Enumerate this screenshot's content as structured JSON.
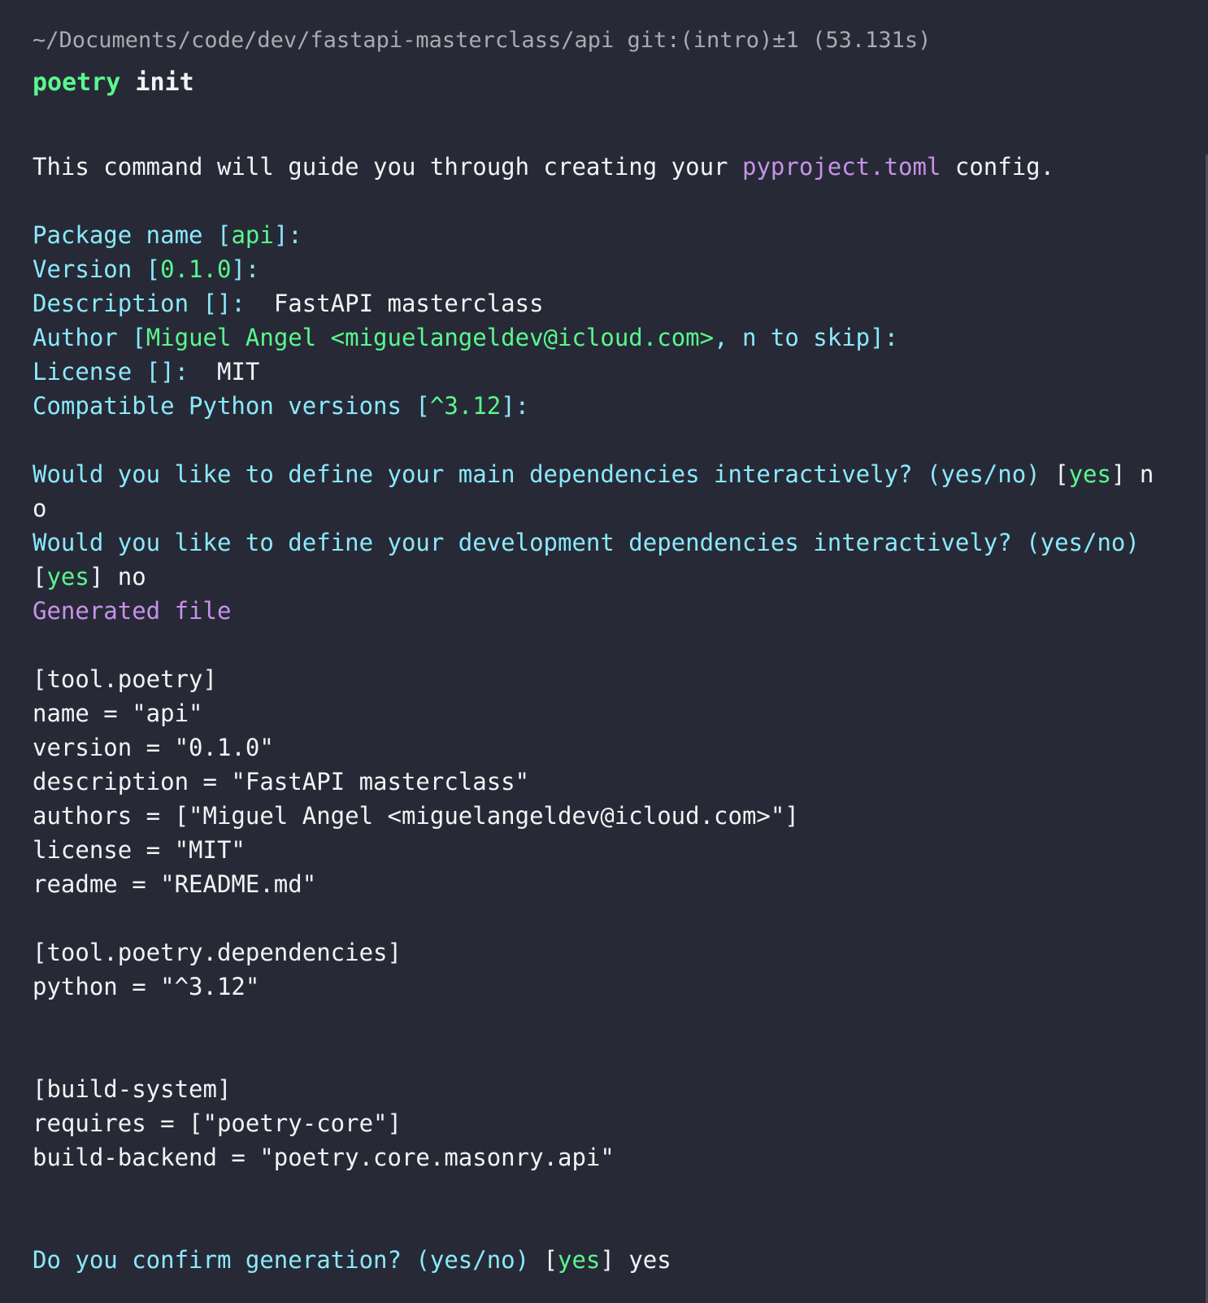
{
  "colors": {
    "background": "#272a36",
    "text": "#f2f3f5",
    "prompt_path": "#a9abb3",
    "command": "#5af78e",
    "question": "#8be9fd",
    "default_value": "#5af78e",
    "highlight": "#c792ea"
  },
  "prompt": {
    "path": "~/Documents/code/dev/fastapi-masterclass/api git:(intro)±1 (53.131s)",
    "command_name": "poetry",
    "command_arg": " init"
  },
  "intro": {
    "before": "This command will guide you through creating your ",
    "file": "pyproject.toml",
    "after": " config."
  },
  "questions": {
    "package": {
      "label": "Package name [",
      "default": "api",
      "suffix": "]:",
      "answer": ""
    },
    "version": {
      "label": "Version [",
      "default": "0.1.0",
      "suffix": "]:",
      "answer": ""
    },
    "description": {
      "label": "Description []:",
      "answer": "  FastAPI masterclass"
    },
    "author": {
      "label": "Author [",
      "default": "Miguel Angel <miguelangeldev@icloud.com>",
      "suffix": ", n to skip]:",
      "answer": ""
    },
    "license": {
      "label": "License []:",
      "answer": "  MIT"
    },
    "python": {
      "label": "Compatible Python versions [",
      "default": "^3.12",
      "suffix": "]:",
      "answer": ""
    },
    "main_deps": {
      "label": "Would you like to define your main dependencies interactively? (yes/no) ",
      "bracket_open": "[",
      "default": "yes",
      "bracket_close": "]",
      "answer_part1": " n",
      "answer_part2": "o"
    },
    "dev_deps": {
      "label": "Would you like to define your development dependencies interactively? (yes/no)",
      "bracket_open": "[",
      "default": "yes",
      "bracket_close": "]",
      "answer": " no"
    },
    "confirm": {
      "label": "Do you confirm generation? (yes/no) ",
      "bracket_open": "[",
      "default": "yes",
      "bracket_close": "]",
      "answer": " yes"
    }
  },
  "generated_label": "Generated file",
  "file_lines": [
    "[tool.poetry]",
    "name = \"api\"",
    "version = \"0.1.0\"",
    "description = \"FastAPI masterclass\"",
    "authors = [\"Miguel Angel <miguelangeldev@icloud.com>\"]",
    "license = \"MIT\"",
    "readme = \"README.md\"",
    "",
    "[tool.poetry.dependencies]",
    "python = \"^3.12\"",
    "",
    "",
    "[build-system]",
    "requires = [\"poetry-core\"]",
    "build-backend = \"poetry.core.masonry.api\""
  ]
}
